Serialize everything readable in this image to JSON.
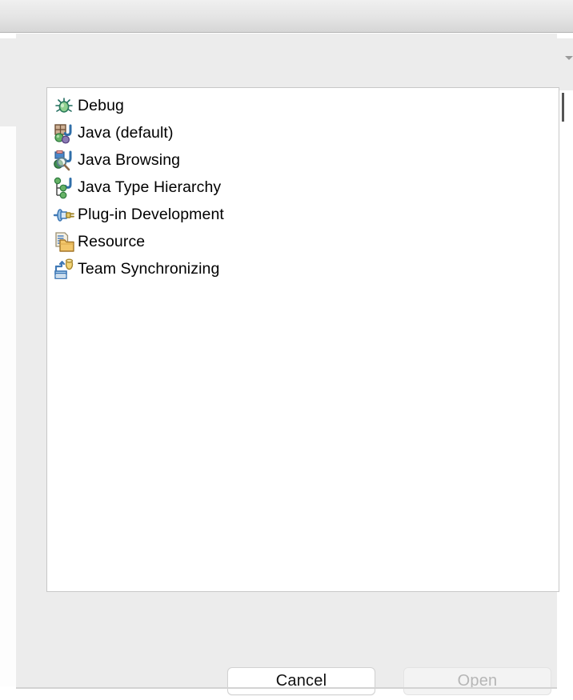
{
  "window": {
    "titlebar_label": "",
    "dialog_type": "open-perspective-sheet"
  },
  "perspective_list": {
    "items": [
      {
        "label": "Debug",
        "icon": "bug-icon"
      },
      {
        "label": "Java (default)",
        "icon": "java-perspective-icon"
      },
      {
        "label": "Java Browsing",
        "icon": "java-browsing-icon"
      },
      {
        "label": "Java Type Hierarchy",
        "icon": "java-type-hierarchy-icon"
      },
      {
        "label": "Plug-in Development",
        "icon": "plugin-icon"
      },
      {
        "label": "Resource",
        "icon": "resource-folder-icon"
      },
      {
        "label": "Team Synchronizing",
        "icon": "team-sync-icon"
      }
    ]
  },
  "buttons": {
    "cancel_label": "Cancel",
    "open_label": "Open",
    "open_enabled": false
  },
  "colors": {
    "sheet_bg": "#ececec",
    "list_bg": "#ffffff",
    "list_border": "#c8c8c8",
    "text": "#000000",
    "disabled_text": "#b6b6b6",
    "titlebar_top": "#f0f0f0",
    "titlebar_bottom": "#d6d6d6"
  }
}
